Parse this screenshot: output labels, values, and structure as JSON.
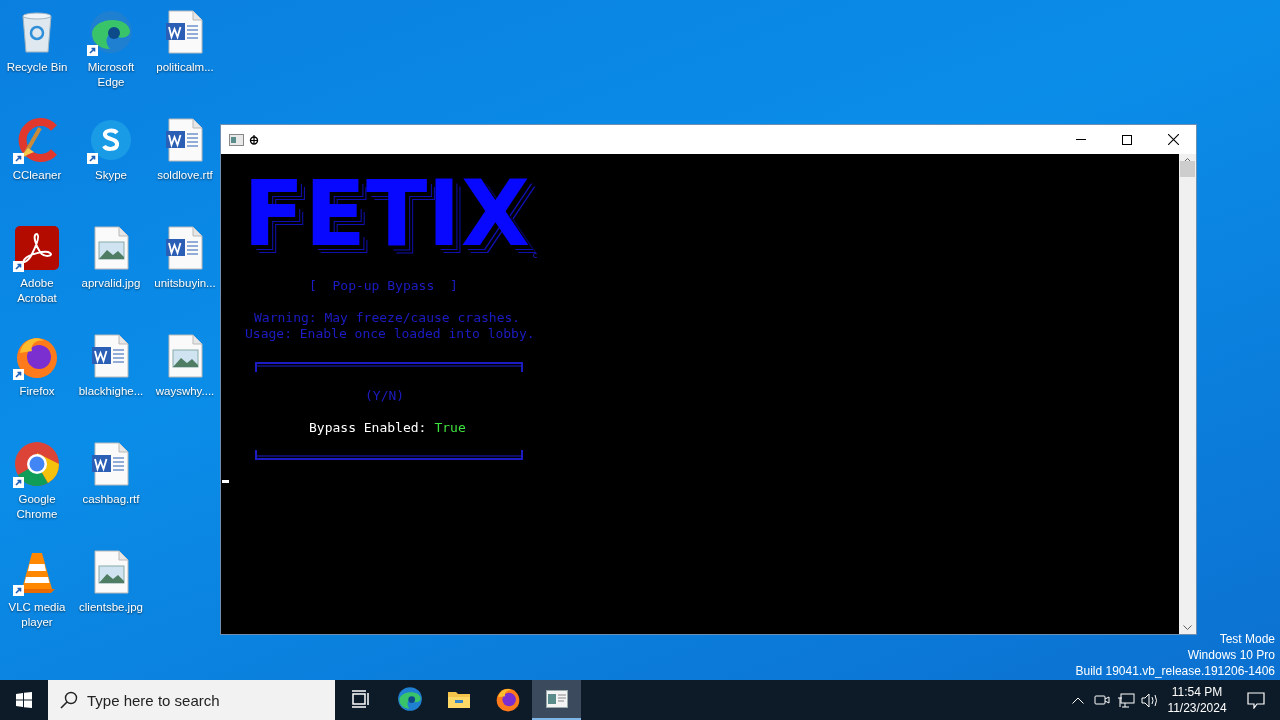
{
  "desktop_rows": [
    [
      {
        "label": "Recycle Bin",
        "kind": "recycle",
        "shortcut": false
      },
      {
        "label": "Microsoft Edge",
        "kind": "edge",
        "shortcut": true
      },
      {
        "label": "politicalm...",
        "kind": "word",
        "shortcut": false
      }
    ],
    [
      {
        "label": "CCleaner",
        "kind": "ccleaner",
        "shortcut": true
      },
      {
        "label": "Skype",
        "kind": "skype",
        "shortcut": true
      },
      {
        "label": "soldlove.rtf",
        "kind": "word",
        "shortcut": false
      }
    ],
    [
      {
        "label": "Adobe Acrobat",
        "kind": "acrobat",
        "shortcut": true
      },
      {
        "label": "aprvalid.jpg",
        "kind": "image",
        "shortcut": false
      },
      {
        "label": "unitsbuyin...",
        "kind": "word",
        "shortcut": false
      }
    ],
    [
      {
        "label": "Firefox",
        "kind": "firefox",
        "shortcut": true
      },
      {
        "label": "blackhighe...",
        "kind": "word",
        "shortcut": false
      },
      {
        "label": "wayswhy....",
        "kind": "image",
        "shortcut": false
      }
    ],
    [
      {
        "label": "Google Chrome",
        "kind": "chrome",
        "shortcut": true
      },
      {
        "label": "cashbag.rtf",
        "kind": "word",
        "shortcut": false
      }
    ],
    [
      {
        "label": "VLC media player",
        "kind": "vlc",
        "shortcut": true
      },
      {
        "label": "clientsbe.jpg",
        "kind": "image",
        "shortcut": false
      }
    ]
  ],
  "console": {
    "logo": "FETIX",
    "logo_mark": "c",
    "subtitle": "[  Pop-up Bypass  ]",
    "notes": [
      "Warning: May freeze/cause crashes.",
      "Usage: Enable once loaded into lobby."
    ],
    "prompt": "(Y/N)",
    "status_label": "Bypass Enabled:",
    "status_value": "True",
    "enabled": true
  },
  "taskbar": {
    "search": {
      "placeholder": "Type here to search"
    },
    "apps": [
      {
        "kind": "taskview",
        "selected": false
      },
      {
        "kind": "edge",
        "selected": false
      },
      {
        "kind": "folder",
        "selected": false
      },
      {
        "kind": "firefox",
        "selected": false
      },
      {
        "kind": "console",
        "selected": true
      }
    ],
    "time": "11:54 PM",
    "date": "11/23/2024"
  },
  "system_notice": [
    "Test Mode",
    "Windows 10 Pro",
    "Build 19041.vb_release.191206-1406"
  ]
}
